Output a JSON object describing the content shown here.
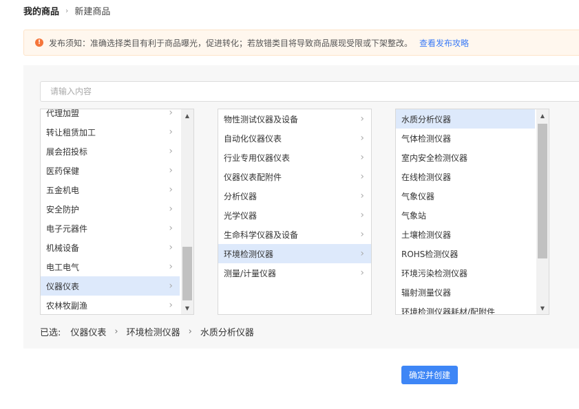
{
  "breadcrumb": {
    "home": "我的商品",
    "separator": "›",
    "current": "新建商品"
  },
  "notice": {
    "icon": "!",
    "text": "发布须知：准确选择类目有利于商品曝光，促进转化；若放错类目将导致商品展现受限或下架整改。",
    "link": "查看发布攻略"
  },
  "search": {
    "placeholder": "请输入内容"
  },
  "chevron": "›",
  "column1": [
    "代理加盟",
    "转让租赁加工",
    "展会招投标",
    "医药保健",
    "五金机电",
    "安全防护",
    "电子元器件",
    "机械设备",
    "电工电气",
    "仪器仪表",
    "农林牧副渔"
  ],
  "column2": [
    "物性测试仪器及设备",
    "自动化仪器仪表",
    "行业专用仪器仪表",
    "仪器仪表配附件",
    "分析仪器",
    "光学仪器",
    "生命科学仪器及设备",
    "环境检测仪器",
    "测量/计量仪器"
  ],
  "column3": [
    "水质分析仪器",
    "气体检测仪器",
    "室内安全检测仪器",
    "在线检测仪器",
    "气象仪器",
    "气象站",
    "土壤检测仪器",
    "ROHS检测仪器",
    "环境污染检测仪器",
    "辐射测量仪器",
    "环境检测仪器耗材/配附件"
  ],
  "selected": {
    "column1": "仪器仪表",
    "column2": "环境检测仪器",
    "column3": "水质分析仪器"
  },
  "selected_path": {
    "label": "已选:",
    "parts": [
      "仪器仪表",
      "环境检测仪器",
      "水质分析仪器"
    ],
    "separator": "›"
  },
  "scroll": {
    "column1_position": 0.9,
    "column3_position": 0.0
  },
  "confirm_button": "确定并创建",
  "colors": {
    "accent": "#3e86f6",
    "selected_bg": "#dde9fb",
    "notice_icon": "#f5753a"
  }
}
